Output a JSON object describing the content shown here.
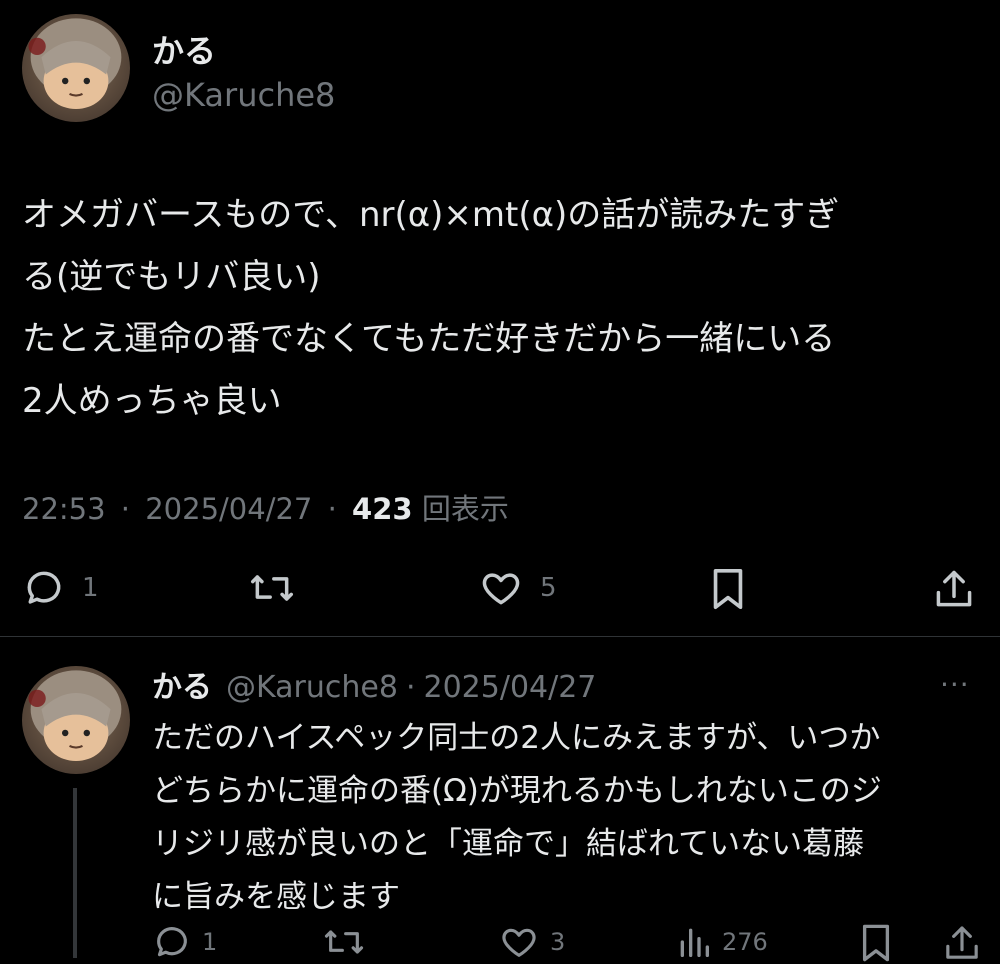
{
  "tweet": {
    "author_name": "かる",
    "author_handle": "@Karuche8",
    "text_lines": [
      "オメガバースもので、nr(α)×mt(α)の話が読みたすぎ",
      "る(逆でもリバ良い)",
      "たとえ運命の番でなくてもただ好きだから一緒にいる",
      "2人めっちゃ良い"
    ],
    "time": "22:53",
    "date": "2025/04/27",
    "sep": "·",
    "views_count": "423",
    "views_label": "回表示",
    "replies": "1",
    "likes": "5"
  },
  "reply": {
    "author_name": "かる",
    "author_handle": "@Karuche8",
    "sep": "·",
    "date": "2025/04/27",
    "more": "···",
    "text_lines": [
      "ただのハイスペック同士の2人にみえますが、いつか",
      "どちらかに運命の番(Ω)が現れるかもしれないこのジ",
      "リジリ感が良いのと「運命で」結ばれていない葛藤",
      "に旨みを感じます"
    ],
    "replies": "1",
    "likes": "3",
    "views": "276"
  },
  "icons": {
    "reply": "reply-icon",
    "retweet": "retweet-icon",
    "like": "heart-icon",
    "bookmark": "bookmark-icon",
    "share": "share-icon",
    "views": "views-icon"
  },
  "colors": {
    "background": "#000000",
    "text": "#e7e9ea",
    "secondary": "#71767b",
    "divider": "#2f3336"
  }
}
